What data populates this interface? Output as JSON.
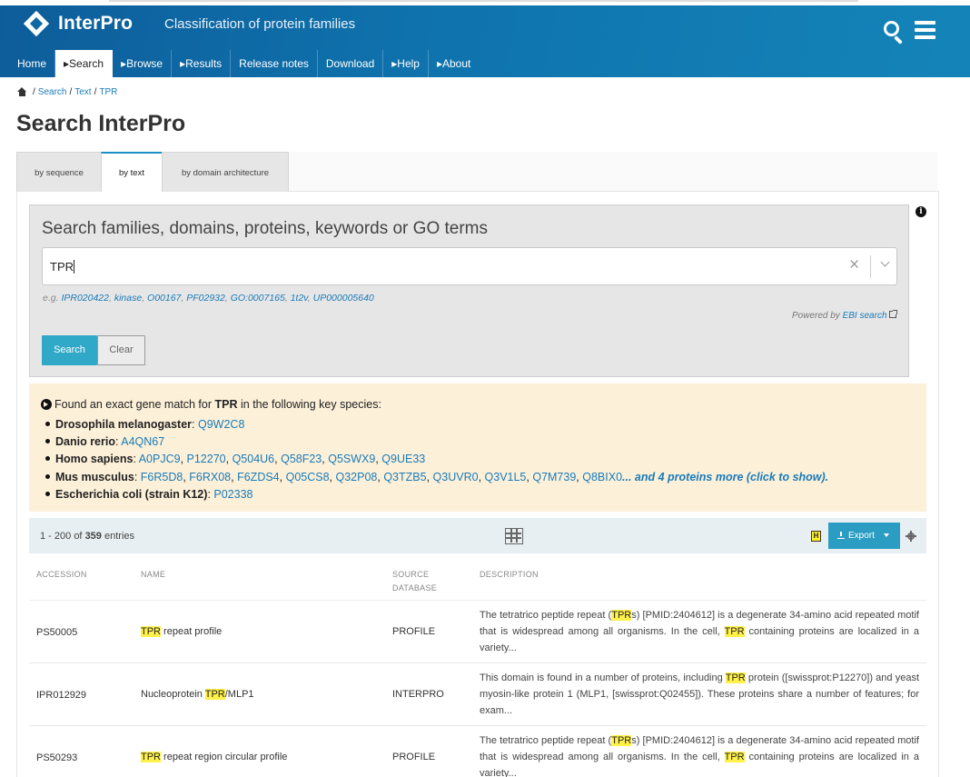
{
  "header": {
    "logo_text": "InterPro",
    "tagline": "Classification of protein families",
    "nav": [
      {
        "label": "Home"
      },
      {
        "label": "▸Search"
      },
      {
        "label": "▸Browse"
      },
      {
        "label": "▸Results"
      },
      {
        "label": "Release notes"
      },
      {
        "label": "Download"
      },
      {
        "label": "▸Help"
      },
      {
        "label": "▸About"
      }
    ]
  },
  "breadcrumb": {
    "items": [
      "Search",
      "Text",
      "TPR"
    ],
    "sep": "/"
  },
  "page_title": "Search InterPro",
  "tabs": [
    {
      "label": "by sequence"
    },
    {
      "label": "by text"
    },
    {
      "label": "by domain architecture"
    }
  ],
  "search": {
    "heading": "Search families, domains, proteins, keywords or GO terms",
    "value": "TPR",
    "clear_symbol": "×",
    "examples_prefix": "e.g.",
    "examples": [
      "IPR020422",
      "kinase",
      "O00167",
      "PF02932",
      "GO:0007165",
      "1t2v",
      "UP000005640"
    ],
    "powered_by_prefix": "Powered by",
    "powered_by_link": "EBI search",
    "search_button": "Search",
    "clear_button": "Clear",
    "info_symbol": "i"
  },
  "gene_match": {
    "intro_pre": "Found an exact gene match for",
    "term": "TPR",
    "intro_post": "in the following key species:",
    "species": [
      {
        "name": "Drosophila melanogaster",
        "accessions": [
          "Q9W2C8"
        ]
      },
      {
        "name": "Danio rerio",
        "accessions": [
          "A4QN67"
        ]
      },
      {
        "name": "Homo sapiens",
        "accessions": [
          "A0PJC9",
          "P12270",
          "Q504U6",
          "Q58F23",
          "Q5SWX9",
          "Q9UE33"
        ]
      },
      {
        "name": "Mus musculus",
        "accessions": [
          "F6R5D8",
          "F6RX08",
          "F6ZDS4",
          "Q05CS8",
          "Q32P08",
          "Q3TZB5",
          "Q3UVR0",
          "Q3V1L5",
          "Q7M739",
          "Q8BIX0"
        ],
        "more": "... and 4 proteins more (click to show)."
      },
      {
        "name": "Escherichia coli (strain K12)",
        "accessions": [
          "P02338"
        ]
      }
    ]
  },
  "results": {
    "range": "1 - 200",
    "of": "of",
    "total": "359",
    "entries_label": "entries",
    "highlight_toggle": "H",
    "export_label": "Export",
    "columns": [
      "ACCESSION",
      "NAME",
      "SOURCE DATABASE",
      "DESCRIPTION"
    ],
    "rows": [
      {
        "accession": "PS50005",
        "name": [
          "TPR",
          " repeat profile"
        ],
        "source": "PROFILE",
        "description": [
          "The tetratrico peptide repeat (",
          "TPR",
          "s) [PMID:2404612] is a degenerate 34-amino acid repeated motif that is widespread among all organisms. In the cell, ",
          "TPR",
          " containing proteins are localized in a variety..."
        ]
      },
      {
        "accession": "IPR012929",
        "name": [
          "Nucleoprotein ",
          "TPR",
          "/MLP1"
        ],
        "source": "INTERPRO",
        "description": [
          "This domain is found in a number of proteins, including ",
          "TPR",
          " protein ([swissprot:P12270]) and yeast myosin-like protein 1 (MLP1, [swissprot:Q02455]). These proteins share a number of features; for exam..."
        ]
      },
      {
        "accession": "PS50293",
        "name": [
          "TPR",
          " repeat region circular profile"
        ],
        "source": "PROFILE",
        "description": [
          "The tetratrico peptide repeat (",
          "TPR",
          "s) [PMID:2404612] is a degenerate 34-amino acid repeated motif that is widespread among all organisms. In the cell, ",
          "TPR",
          " containing proteins are localized in a variety..."
        ]
      }
    ]
  },
  "colors": {
    "header_blue": "#0f73ad",
    "accent_teal": "#30a8c8",
    "highlight": "#fff04a",
    "gene_box_bg": "#fcf0d9",
    "link": "#1a7bb9"
  }
}
